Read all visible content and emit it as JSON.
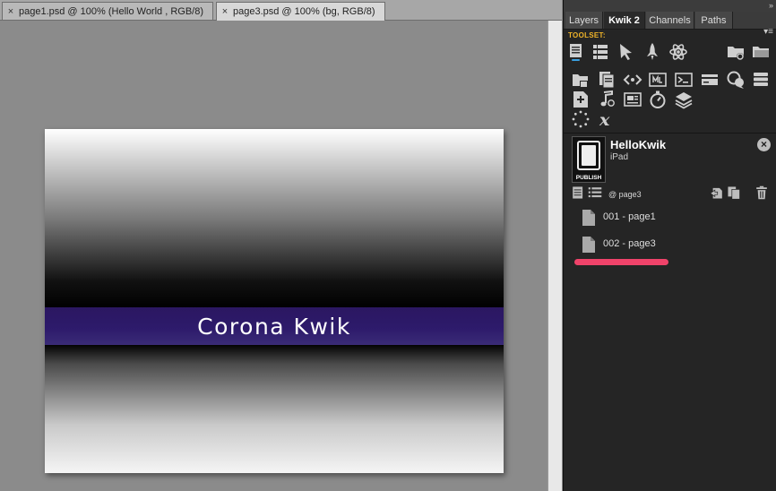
{
  "document_tabs": [
    {
      "close": "×",
      "label": "page1.psd @ 100% (Hello World , RGB/8)"
    },
    {
      "close": "×",
      "label": "page3.psd @ 100% (bg, RGB/8)"
    }
  ],
  "canvas": {
    "banner_text": "Corona Kwik",
    "banner_color": "#2d1a6b"
  },
  "panel": {
    "collapse": "»",
    "tabs": [
      "Layers",
      "Kwik 2",
      "Channels",
      "Paths"
    ],
    "active_tab": "Kwik 2",
    "menu": "▾≡",
    "toolset_label": "TOOLSET:",
    "toolset_label_color": "#f0b429",
    "tool_icons": [
      "toolset-doc-icon",
      "list-icon",
      "pointer-icon",
      "rocket-icon",
      "atom-icon",
      "folder-add-icon",
      "folder-icon",
      "folder-image-icon",
      "pages-icon",
      "code-icon",
      "video-icon",
      "terminal-icon",
      "card-icon",
      "speech-icon",
      "stack-icon",
      "add-page-icon",
      "music-icon",
      "frame-icon",
      "timer-icon",
      "layers-icon",
      "spinner-icon",
      "variable-icon"
    ],
    "project": {
      "name": "HelloKwik",
      "device": "iPad",
      "publish_label": "PUBLISH",
      "close": "×"
    },
    "current_page": "@ page3",
    "pages": [
      {
        "label": "001 - page1"
      },
      {
        "label": "002 - page3"
      }
    ],
    "accent_color": "#f0436a"
  }
}
